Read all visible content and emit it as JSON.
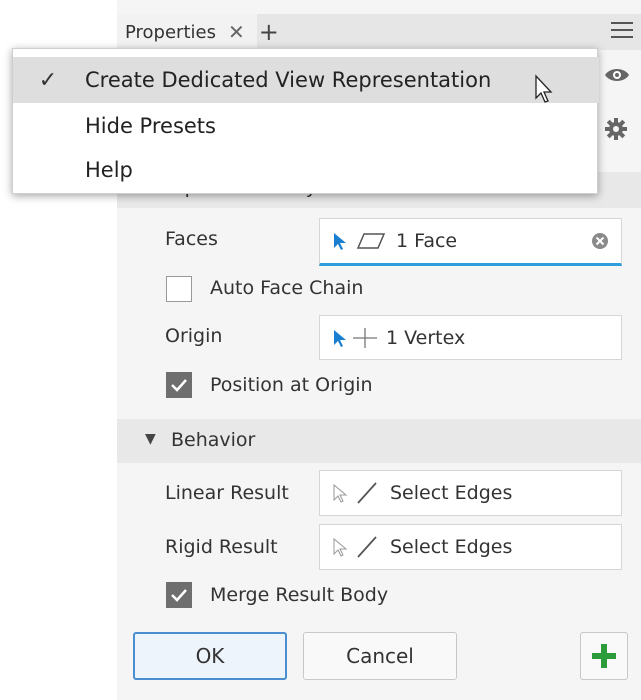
{
  "tab": {
    "title": "Properties",
    "close": "✕",
    "add": "+"
  },
  "menu": {
    "items": [
      {
        "label": "Create Dedicated View Representation",
        "checked": "✓"
      },
      {
        "label": "Hide Presets"
      },
      {
        "label": "Help"
      }
    ]
  },
  "input_geometry": {
    "header": "Input Geometry",
    "faces_label": "Faces",
    "faces_value": "1 Face",
    "auto_face_chain_label": "Auto Face Chain",
    "auto_face_chain_checked": false,
    "origin_label": "Origin",
    "origin_value": "1 Vertex",
    "position_at_origin_label": "Position at Origin",
    "position_at_origin_checked": true
  },
  "behavior": {
    "header": "Behavior",
    "linear_label": "Linear Result",
    "linear_value": "Select Edges",
    "rigid_label": "Rigid Result",
    "rigid_value": "Select Edges",
    "merge_label": "Merge Result Body",
    "merge_checked": true
  },
  "buttons": {
    "ok": "OK",
    "cancel": "Cancel",
    "add": "+"
  },
  "colors": {
    "accent": "#2f9fdc",
    "add_green": "#2a9d3a",
    "selection_blue": "#1a7fd0"
  }
}
